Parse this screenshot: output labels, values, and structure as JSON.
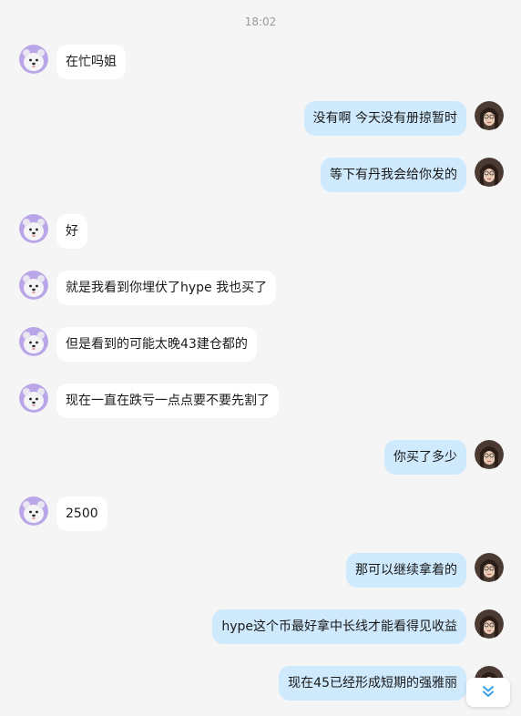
{
  "chat": {
    "timestamp": "18:02",
    "messages": [
      {
        "side": "left",
        "text": "在忙吗姐"
      },
      {
        "side": "right",
        "text": "没有啊 今天没有册掠暂时"
      },
      {
        "side": "right",
        "text": "等下有丹我会给你发的"
      },
      {
        "side": "left",
        "text": "好"
      },
      {
        "side": "left",
        "text": "就是我看到你埋伏了hype 我也买了"
      },
      {
        "side": "left",
        "text": "但是看到的可能太晚43建仓都的"
      },
      {
        "side": "left",
        "text": "现在一直在跌亏一点点要不要先割了"
      },
      {
        "side": "right",
        "text": "你买了多少"
      },
      {
        "side": "left",
        "text": "2500"
      },
      {
        "side": "right",
        "text": "那可以继续拿着的"
      },
      {
        "side": "right",
        "text": "hype这个币最好拿中长线才能看得见收益"
      },
      {
        "side": "right",
        "text": "现在45已经形成短期的强雅丽"
      }
    ],
    "scroll_button_icon": "double-chevron-down-icon",
    "colors": {
      "background": "#f5f5f5",
      "incoming_bubble": "#ffffff",
      "outgoing_bubble": "#cfe9fd",
      "accent": "#3aa3e8"
    }
  }
}
